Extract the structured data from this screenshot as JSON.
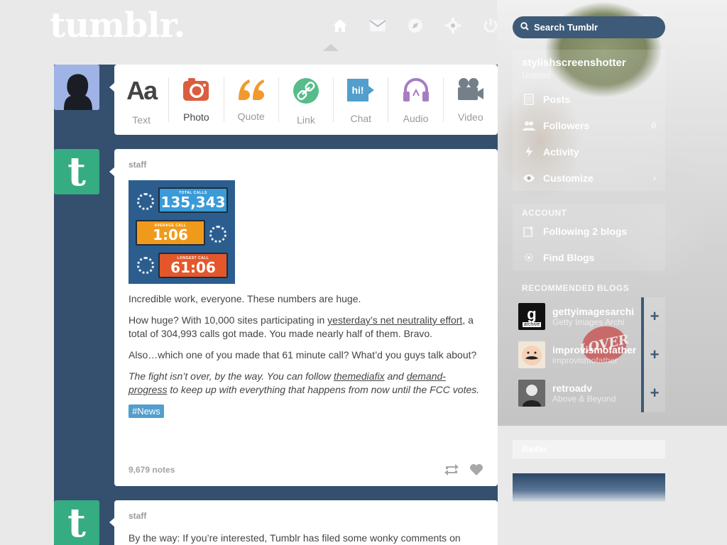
{
  "app": {
    "logo_text": "tumblr."
  },
  "header": {
    "nav": [
      {
        "name": "home-icon",
        "active": true
      },
      {
        "name": "mail-icon",
        "active": false
      },
      {
        "name": "compass-icon",
        "active": false
      },
      {
        "name": "gear-icon",
        "active": false
      },
      {
        "name": "power-icon",
        "active": false
      }
    ],
    "search": {
      "placeholder": "Search Tumblr"
    }
  },
  "post_box": {
    "types": [
      {
        "key": "text",
        "label": "Text",
        "color": "#444444"
      },
      {
        "key": "photo",
        "label": "Photo",
        "color": "#d95e40"
      },
      {
        "key": "quote",
        "label": "Quote",
        "color": "#f2992e"
      },
      {
        "key": "link",
        "label": "Link",
        "color": "#56bc8a"
      },
      {
        "key": "chat",
        "label": "Chat",
        "color": "#529ecc"
      },
      {
        "key": "audio",
        "label": "Audio",
        "color": "#a77dc2"
      },
      {
        "key": "video",
        "label": "Video",
        "color": "#748089"
      }
    ]
  },
  "posts": [
    {
      "author": "staff",
      "image": {
        "total_label": "TOTAL CALLS",
        "total": "135,343",
        "avg_label": "AVERAGE CALL",
        "avg": "1:06",
        "longest_label": "LONGEST CALL",
        "longest": "61:06"
      },
      "p1": "Incredible work, everyone. These numbers are huge.",
      "p2_before": "How huge? With 10,000 sites participating in ",
      "p2_link": "yesterday’s net neutrality effort",
      "p2_after": ", a total of 304,993 calls got made. You made nearly half of them. Bravo.",
      "p3": "Also…which one of you made that 61 minute call? What’d you guys talk about?",
      "p4_before": "The fight isn’t over, by the way. You can follow ",
      "p4_link1": "themediafix",
      "p4_mid": " and ",
      "p4_link2": "demand-progress",
      "p4_after": " to keep up with everything that happens from now until the FCC votes.",
      "tag": "#News",
      "notes": "9,679 notes"
    },
    {
      "author": "staff",
      "p1": "By the way: If you’re interested, Tumblr has filed some wonky comments on"
    }
  ],
  "sidebar": {
    "blog": {
      "name": "stylishscreenshotter",
      "subtitle": "Untitled"
    },
    "items": [
      {
        "icon": "posts-icon",
        "label": "Posts",
        "count": ""
      },
      {
        "icon": "followers-icon",
        "label": "Followers",
        "count": "0"
      },
      {
        "icon": "activity-icon",
        "label": "Activity",
        "count": ""
      },
      {
        "icon": "eye-icon",
        "label": "Customize",
        "count": ""
      }
    ],
    "account_title": "Account",
    "account_items": [
      {
        "icon": "following-icon",
        "label": "Following 2 blogs"
      },
      {
        "icon": "find-blogs-icon",
        "label": "Find Blogs"
      }
    ],
    "recommended_title": "Recommended Blogs",
    "recommended": [
      {
        "name": "gettyimagesarchi",
        "subtitle": "Getty Images Archi",
        "avatar_text": "g",
        "avatar_sub": "archive",
        "avatar_color": "#111111"
      },
      {
        "name": "improvismofather",
        "subtitle": "improvismofather",
        "avatar_text": "",
        "avatar_sub": "",
        "avatar_color": "#f1e6da"
      },
      {
        "name": "retroadv",
        "subtitle": "Above & Beyond",
        "avatar_text": "",
        "avatar_sub": "",
        "avatar_color": "#555555"
      }
    ],
    "radar_title": "Radar"
  }
}
